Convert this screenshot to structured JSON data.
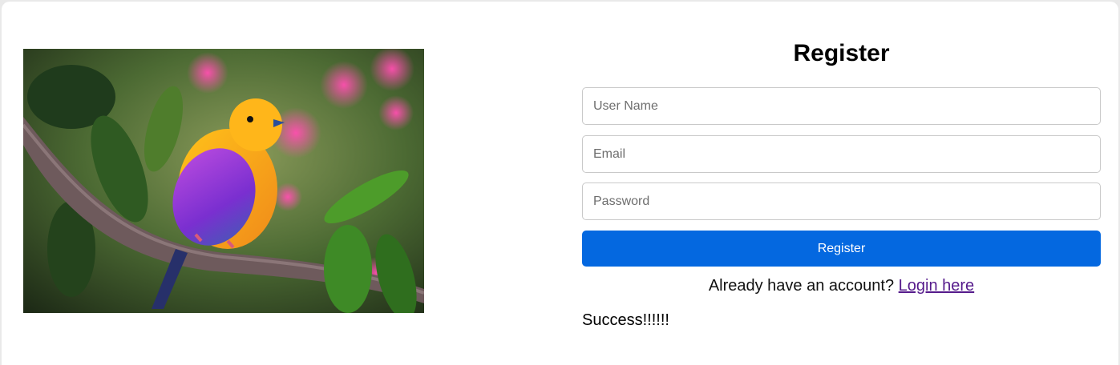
{
  "register_form": {
    "title": "Register",
    "username_placeholder": "User Name",
    "email_placeholder": "Email",
    "password_placeholder": "Password",
    "submit_label": "Register",
    "login_prompt": "Already have an account?",
    "login_link": "Login here",
    "status_message": "Success!!!!!!"
  },
  "colors": {
    "primary_button": "#0468e0",
    "visited_link": "#551a8b"
  }
}
